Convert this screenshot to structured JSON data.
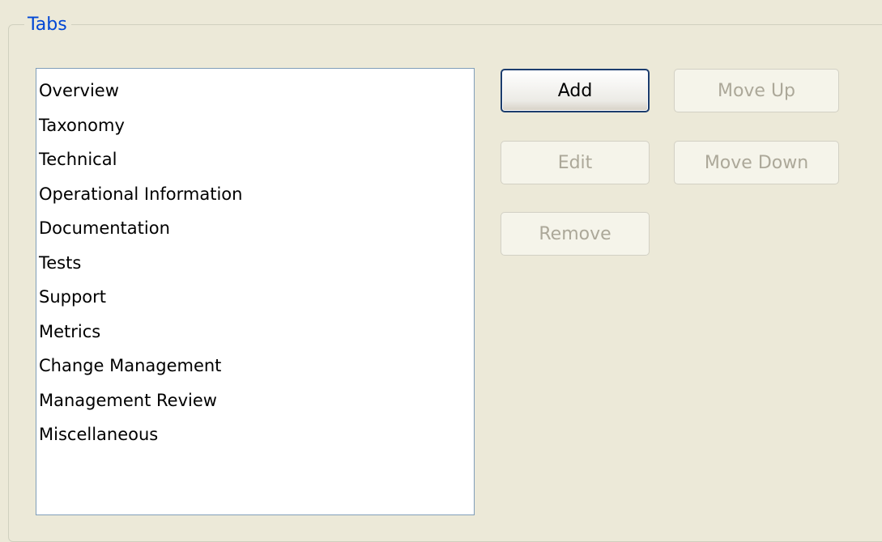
{
  "group": {
    "title": "Tabs"
  },
  "tabs_list": {
    "items": [
      "Overview",
      "Taxonomy",
      "Technical",
      "Operational Information",
      "Documentation",
      "Tests",
      "Support",
      "Metrics",
      "Change Management",
      "Management Review",
      "Miscellaneous"
    ]
  },
  "buttons": {
    "add": "Add",
    "edit": "Edit",
    "remove": "Remove",
    "move_up": "Move Up",
    "move_down": "Move Down"
  },
  "state": {
    "add_enabled": true,
    "edit_enabled": false,
    "remove_enabled": false,
    "move_up_enabled": false,
    "move_down_enabled": false
  },
  "colors": {
    "dialog_background": "#ece9d8",
    "group_title": "#0046d5",
    "list_border": "#7f9db9",
    "disabled_text": "#aca899",
    "default_button_border": "#1c3d6e"
  }
}
